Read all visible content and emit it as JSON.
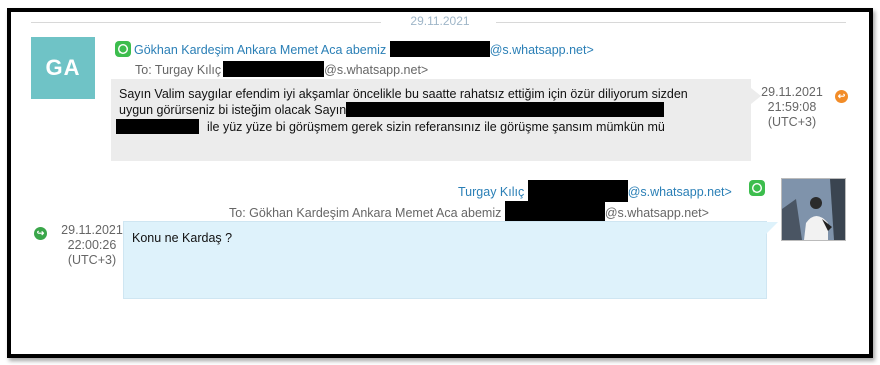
{
  "date_separator": "29.11.2021",
  "messages": [
    {
      "avatar_initials": "GA",
      "sender_name": "Gökhan Kardeşim Ankara Memet Aca abemiz",
      "sender_suffix": "@s.whatsapp.net>",
      "to_prefix": "To: Turgay Kılıç",
      "to_suffix": "@s.whatsapp.net>",
      "text_line1": "Sayın Valim saygılar efendim iyi akşamlar öncelikle bu saatte rahatsız ettiğim için özür diliyorum sizden",
      "text_line2": "uygun görürseniz bi isteğim olacak Sayın",
      "text_line3": "ile yüz yüze bi görüşmem gerek  sizin referansınız ile görüşme şansım mümkün mü",
      "timestamp_date": "29.11.2021",
      "timestamp_time": "21:59:08",
      "timestamp_tz": "(UTC+3)",
      "status_color": "#f28c28"
    },
    {
      "sender_name": "Turgay Kılıç",
      "sender_suffix": "@s.whatsapp.net>",
      "to_prefix": "To: Gökhan Kardeşim Ankara Memet Aca abemiz",
      "to_suffix": "@s.whatsapp.net>",
      "text_line1": "Konu ne Kardaş ?",
      "timestamp_date": "29.11.2021",
      "timestamp_time": "22:00:26",
      "timestamp_tz": "(UTC+3)",
      "status_color": "#3aa64a"
    }
  ],
  "colors": {
    "sender_blue": "#2a7fb6",
    "avatar_teal": "#6fc3c6",
    "whatsapp_green": "#3cbd4d",
    "incoming_bubble": "#ececec",
    "outgoing_bubble": "#def2fb"
  }
}
